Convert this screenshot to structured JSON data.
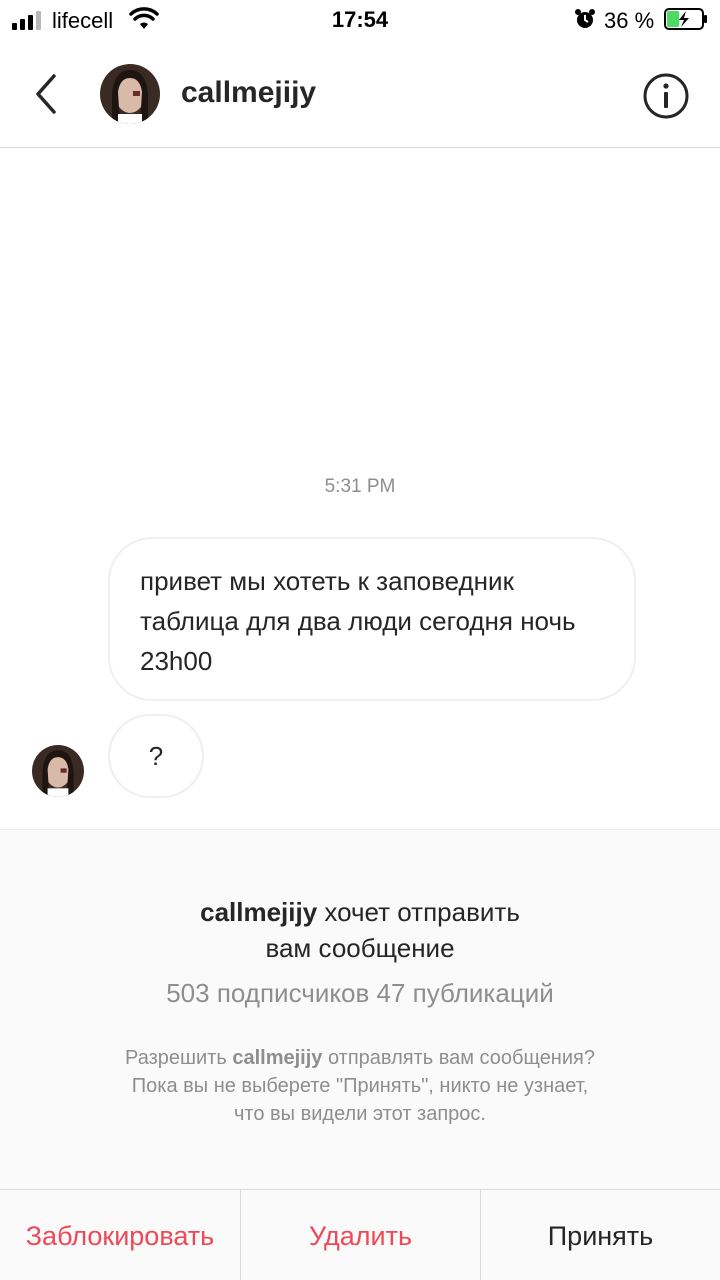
{
  "status_bar": {
    "carrier": "lifecell",
    "time": "17:54",
    "battery_percent": "36 %",
    "battery_level": 0.36,
    "icons": [
      "signal-icon",
      "wifi-icon",
      "alarm-icon",
      "battery-charging-icon"
    ]
  },
  "header": {
    "username": "callmejijy",
    "icons": [
      "back-chevron-icon",
      "avatar-photo",
      "info-icon"
    ]
  },
  "chat": {
    "timestamp": "5:31 PM",
    "messages": [
      {
        "text": "привет мы хотеть к заповедник таблица для два люди сегодня ночь 23h00"
      },
      {
        "text": "?"
      }
    ]
  },
  "request": {
    "title_user": "callmejijy",
    "title_rest_line1": " хочет отправить",
    "title_line2": "вам сообщение",
    "stats": "503 подписчиков 47 публикаций",
    "info_prefix": "Разрешить ",
    "info_user": "callmejijy",
    "info_suffix": " отправлять вам сообщения?",
    "info_line2": "Пока вы не выберете \"Принять\", никто не узнает,",
    "info_line3": "что вы видели этот запрос."
  },
  "actions": {
    "block_label": "Заблокировать",
    "delete_label": "Удалить",
    "accept_label": "Принять"
  },
  "colors": {
    "danger": "#ed4956",
    "muted": "#8e8e8e",
    "text": "#262626",
    "battery_fill": "#4cd964"
  }
}
